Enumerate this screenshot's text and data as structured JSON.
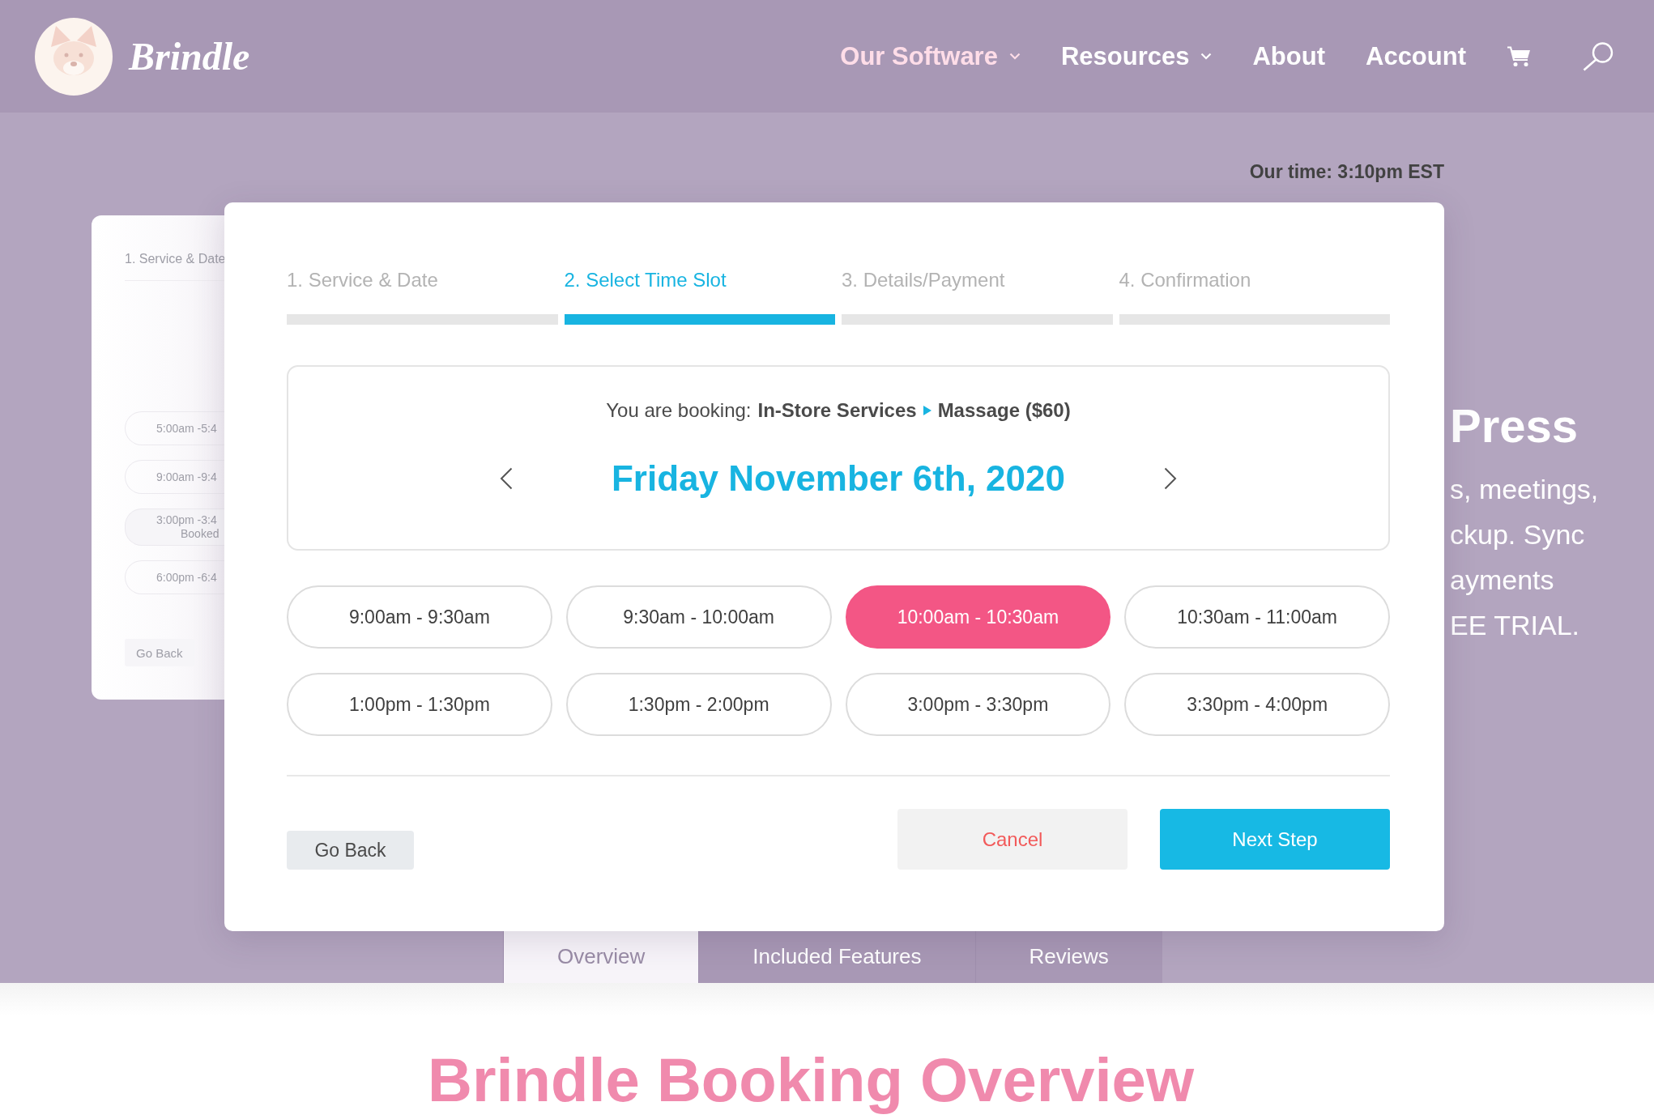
{
  "header": {
    "logo_text": "Brindle",
    "nav": [
      {
        "label": "Our Software",
        "selected": true,
        "dropdown": true
      },
      {
        "label": "Resources",
        "selected": false,
        "dropdown": true
      },
      {
        "label": "About",
        "selected": false,
        "dropdown": false
      },
      {
        "label": "Account",
        "selected": false,
        "dropdown": false
      }
    ]
  },
  "background_card": {
    "step_label": "1. Service & Date",
    "slots": [
      {
        "label": "5:00am -5:4",
        "booked": false
      },
      {
        "label": "9:00am -9:4",
        "booked": false
      },
      {
        "label": "3:00pm -3:4",
        "note": "Booked",
        "booked": true
      },
      {
        "label": "6:00pm -6:4",
        "booked": false
      }
    ],
    "back_button": "Go Back"
  },
  "hero": {
    "title": "Press",
    "lines": [
      "s, meetings,",
      "ckup. Sync",
      "ayments",
      "EE TRIAL."
    ]
  },
  "page_tabs": [
    {
      "label": "Overview",
      "selected": true
    },
    {
      "label": "Included Features",
      "selected": false
    },
    {
      "label": "Reviews",
      "selected": false
    }
  ],
  "section_title": "Brindle Booking Overview",
  "booking_modal": {
    "time_note": "Our time: 3:10pm EST",
    "steps": [
      {
        "label": "1. Service & Date",
        "selected": false
      },
      {
        "label": "2. Select Time Slot",
        "selected": true
      },
      {
        "label": "3. Details/Payment",
        "selected": false
      },
      {
        "label": "4. Confirmation",
        "selected": false
      }
    ],
    "booking": {
      "label": "You are booking:",
      "category": "In-Store Services",
      "service": "Massage ($60)"
    },
    "date": "Friday November 6th, 2020",
    "slots": [
      {
        "label": "9:00am - 9:30am",
        "selected": false
      },
      {
        "label": "9:30am - 10:00am",
        "selected": false
      },
      {
        "label": "10:00am - 10:30am",
        "selected": true
      },
      {
        "label": "10:30am - 11:00am",
        "selected": false
      },
      {
        "label": "1:00pm - 1:30pm",
        "selected": false
      },
      {
        "label": "1:30pm - 2:00pm",
        "selected": false
      },
      {
        "label": "3:00pm - 3:30pm",
        "selected": false
      },
      {
        "label": "3:30pm - 4:00pm",
        "selected": false
      }
    ],
    "actions": [
      {
        "label": "Go Back",
        "kind": "secondary"
      },
      {
        "label": "Cancel",
        "kind": "cancel"
      },
      {
        "label": "Next Step",
        "kind": "primary"
      }
    ]
  }
}
